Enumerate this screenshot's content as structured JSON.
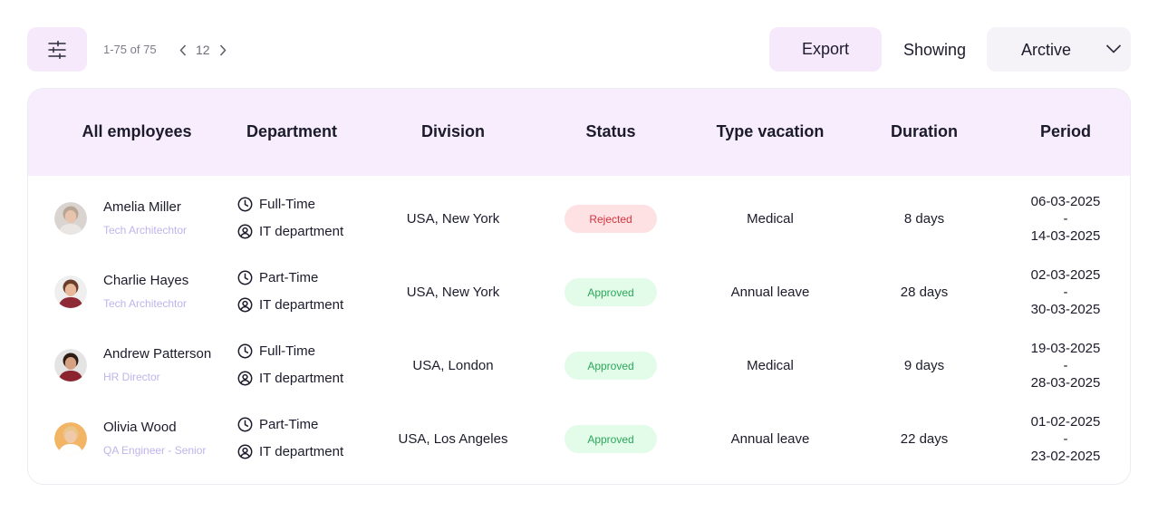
{
  "toolbar": {
    "pager_info": "1-75 of 75",
    "page_number": "12",
    "export_label": "Export",
    "showing_label": "Showing",
    "showing_value": "Arctive"
  },
  "table": {
    "headers": [
      "All employees",
      "Department",
      "Division",
      "Status",
      "Type vacation",
      "Duration",
      "Period"
    ],
    "rows": [
      {
        "name": "Amelia Miller",
        "role": "Tech Architechtor",
        "employment": "Full-Time",
        "department": "IT department",
        "division": "USA, New York",
        "status": "Rejected",
        "status_kind": "rejected",
        "vacation": "Medical",
        "duration": "8 days",
        "period_start": "06-03-2025",
        "period_sep": "-",
        "period_end": "14-03-2025",
        "avatar_colors": {
          "bg": "#d9d4d0",
          "skin": "#e8c4ad",
          "hair": "#b9a593",
          "shirt": "#e9e6e4"
        }
      },
      {
        "name": "Charlie Hayes",
        "role": "Tech Architechtor",
        "employment": "Part-Time",
        "department": "IT department",
        "division": "USA, New York",
        "status": "Approved",
        "status_kind": "approved",
        "vacation": "Annual leave",
        "duration": "28 days",
        "period_start": "02-03-2025",
        "period_sep": "-",
        "period_end": "30-03-2025",
        "avatar_colors": {
          "bg": "#efefef",
          "skin": "#e8b89a",
          "hair": "#6b3f2a",
          "shirt": "#8e2a35"
        }
      },
      {
        "name": "Andrew Patterson",
        "role": "HR Director",
        "employment": "Full-Time",
        "department": "IT department",
        "division": "USA, London",
        "status": "Approved",
        "status_kind": "approved",
        "vacation": "Medical",
        "duration": "9 days",
        "period_start": "19-03-2025",
        "period_sep": "-",
        "period_end": "28-03-2025",
        "avatar_colors": {
          "bg": "#e4e4e4",
          "skin": "#d6a183",
          "hair": "#2e1d15",
          "shirt": "#8c2430"
        }
      },
      {
        "name": "Olivia Wood",
        "role": "QA Engineer - Senior",
        "employment": "Part-Time",
        "department": "IT department",
        "division": "USA, Los Angeles",
        "status": "Approved",
        "status_kind": "approved",
        "vacation": "Annual leave",
        "duration": "22 days",
        "period_start": "01-02-2025",
        "period_sep": "-",
        "period_end": "23-02-2025",
        "avatar_colors": {
          "bg": "#f2b566",
          "skin": "#f0c9ab",
          "hair": "#e9c58a",
          "shirt": "#ffffff"
        }
      }
    ]
  }
}
